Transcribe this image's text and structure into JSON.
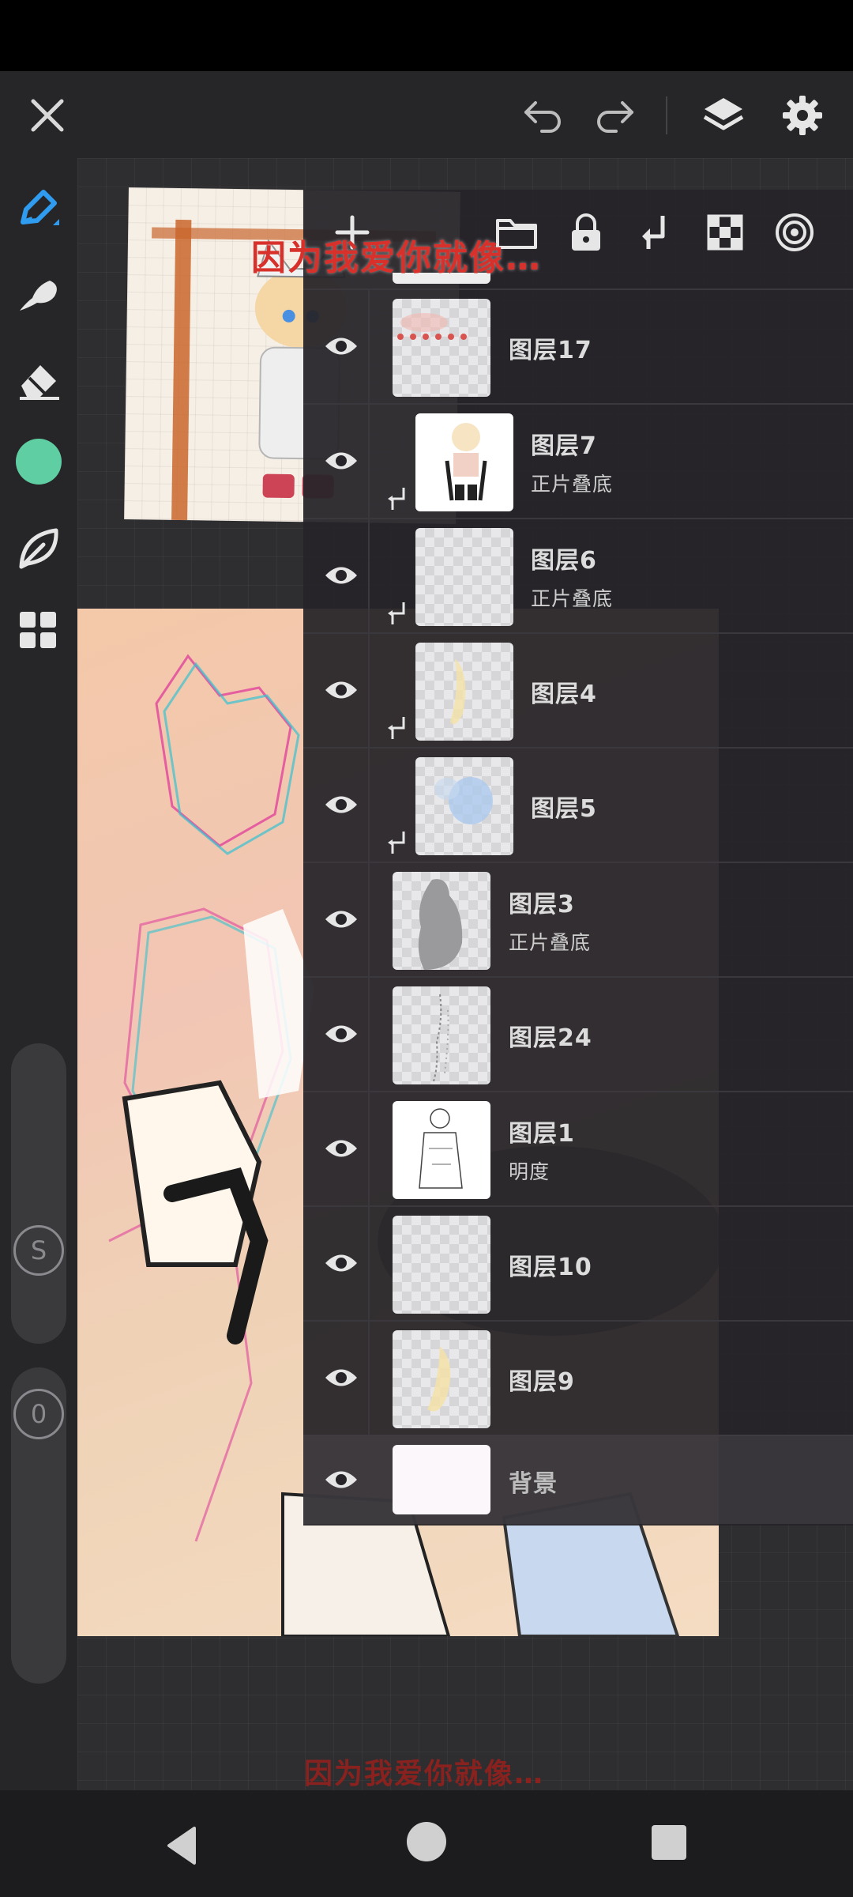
{
  "overlay_caption": "因为我爱你就像…",
  "overlay_caption_bottom": "因为我爱你就像…",
  "topbar": {
    "icons": [
      "close-icon",
      "undo-icon",
      "redo-icon",
      "layers-icon",
      "settings-icon"
    ]
  },
  "left_toolbar": {
    "tools": [
      "brush-icon",
      "smudge-icon",
      "eraser-icon",
      "color-swatch",
      "leaf-icon",
      "grid-icon"
    ],
    "active_color": "#5fcfa3",
    "size_button": "S",
    "opacity_button": "0"
  },
  "layers_toolbar": {
    "icons": [
      "add-layer-icon",
      "folder-icon",
      "lock-icon",
      "merge-down-icon",
      "checker-icon",
      "blend-icon"
    ]
  },
  "layers": [
    {
      "name": "图层17",
      "mode": "",
      "clipped": false
    },
    {
      "name": "图层7",
      "mode": "正片叠底",
      "clipped": true
    },
    {
      "name": "图层6",
      "mode": "正片叠底",
      "clipped": true
    },
    {
      "name": "图层4",
      "mode": "",
      "clipped": true
    },
    {
      "name": "图层5",
      "mode": "",
      "clipped": true
    },
    {
      "name": "图层3",
      "mode": "正片叠底",
      "clipped": false
    },
    {
      "name": "图层24",
      "mode": "",
      "clipped": false
    },
    {
      "name": "图层1",
      "mode": "明度",
      "clipped": false
    },
    {
      "name": "图层10",
      "mode": "",
      "clipped": false
    },
    {
      "name": "图层9",
      "mode": "",
      "clipped": false
    },
    {
      "name": "背景",
      "mode": "",
      "clipped": false
    }
  ],
  "navbar": {
    "icons": [
      "back-icon",
      "home-icon",
      "recents-icon"
    ]
  }
}
